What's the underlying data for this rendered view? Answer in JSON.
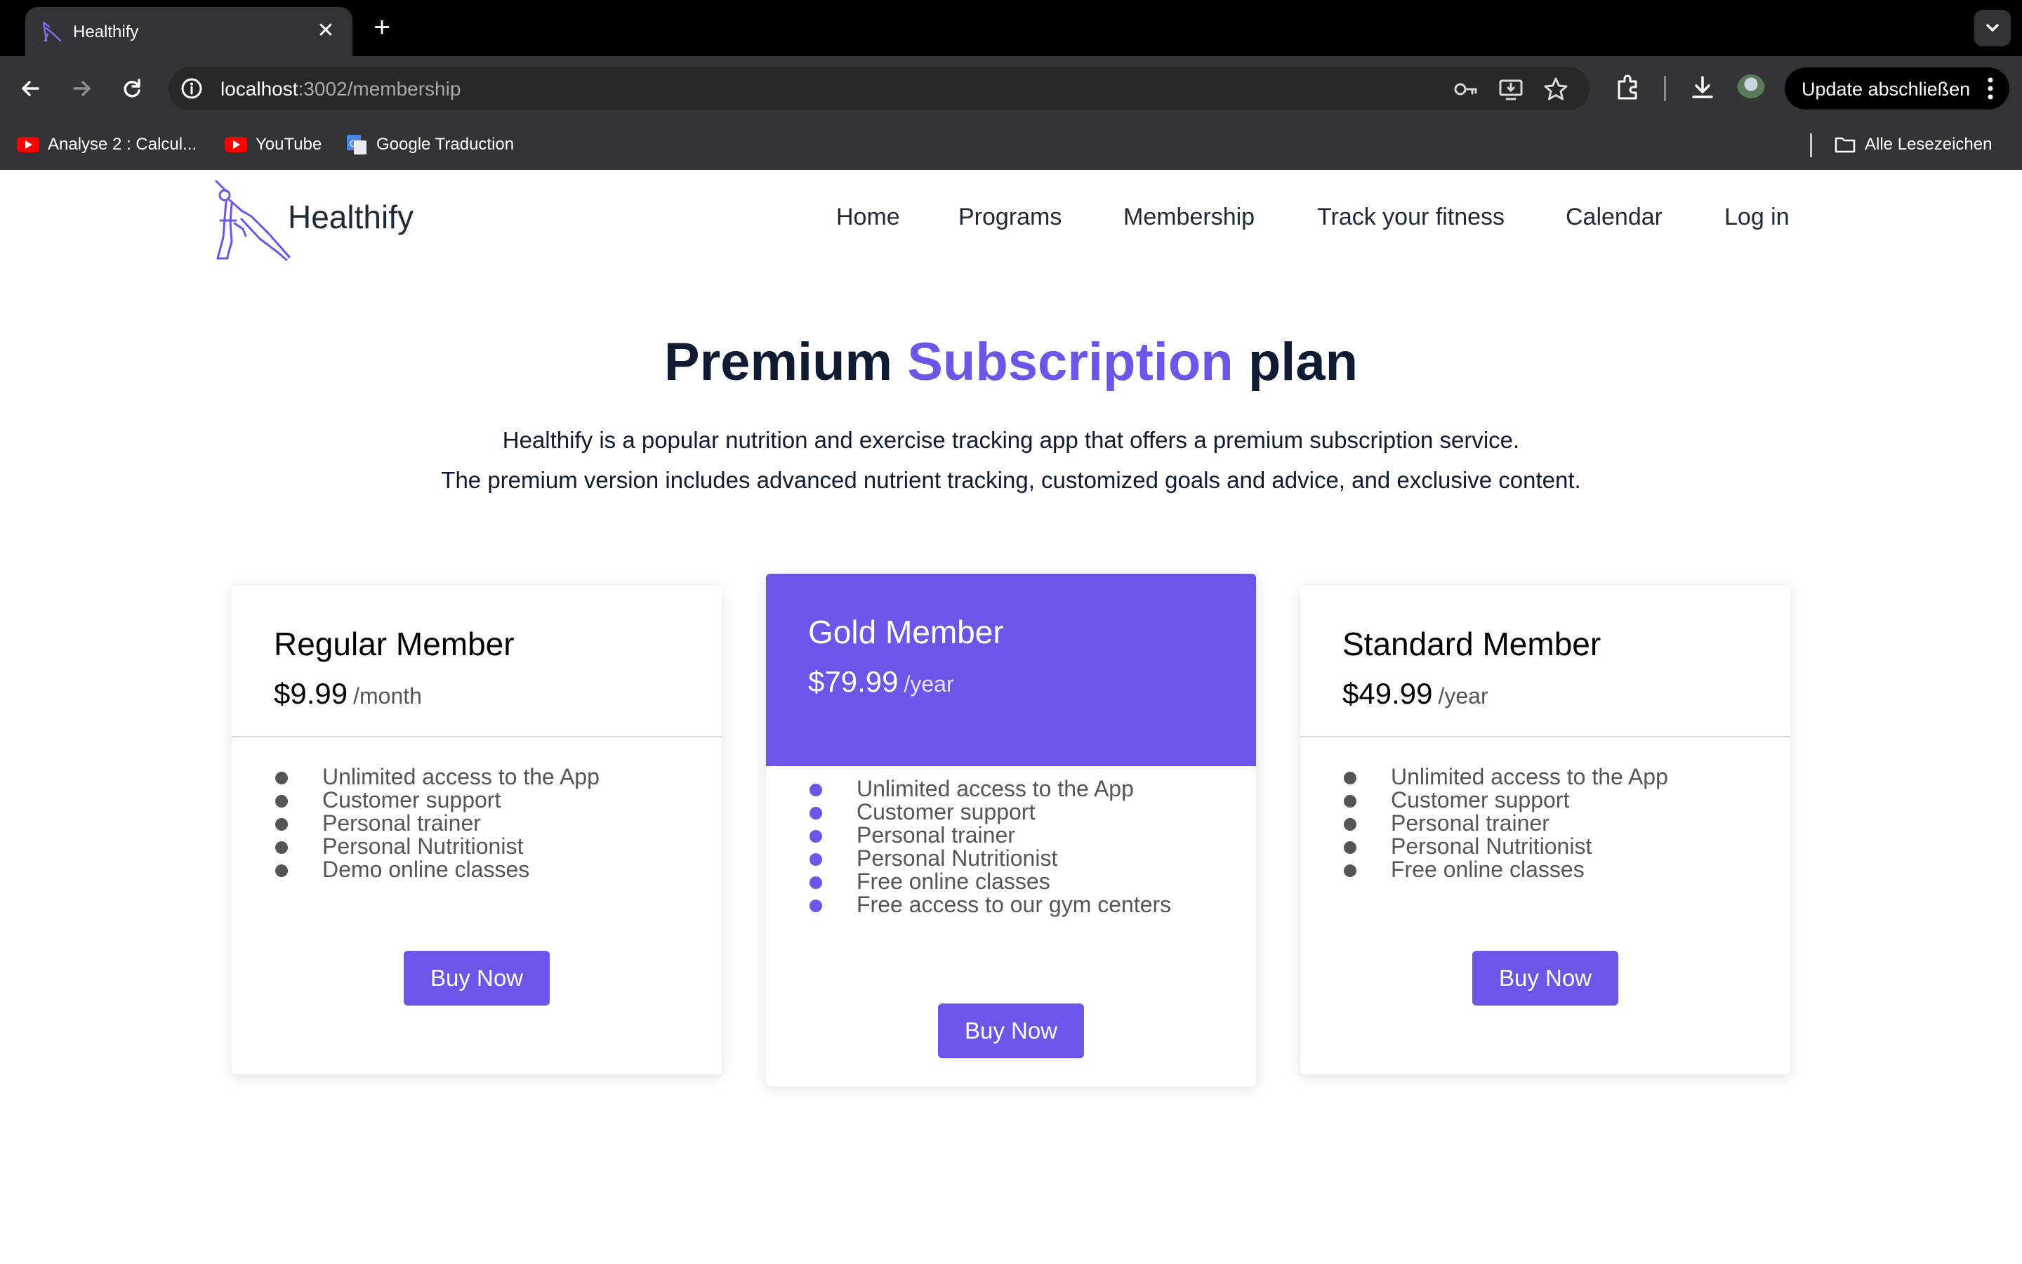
{
  "browser": {
    "tab_title": "Healthify",
    "url_host": "localhost",
    "url_rest": ":3002/membership",
    "update_label": "Update abschließen",
    "bookmarks": [
      {
        "label": "Analyse 2 : Calcul...",
        "icon": "youtube-icon"
      },
      {
        "label": "YouTube",
        "icon": "youtube-icon"
      },
      {
        "label": "Google Traduction",
        "icon": "google-translate-icon"
      }
    ],
    "all_bookmarks_label": "Alle Lesezeichen"
  },
  "site": {
    "brand": "Healthify",
    "nav": [
      "Home",
      "Programs",
      "Membership",
      "Track your fitness",
      "Calendar",
      "Log in"
    ]
  },
  "hero": {
    "title_pre": "Premium ",
    "title_accent": "Subscription",
    "title_post": " plan",
    "line1": "Healthify is a popular nutrition and exercise tracking app that offers a premium subscription service.",
    "line2": "The premium version includes advanced nutrient tracking, customized goals and advice, and exclusive content."
  },
  "plans": [
    {
      "name": "Regular Member",
      "price": "$9.99",
      "period": "/month",
      "features": [
        "Unlimited access to the App",
        "Customer support",
        "Personal trainer",
        "Personal Nutritionist",
        "Demo online classes"
      ],
      "button": "Buy Now"
    },
    {
      "name": "Gold Member",
      "price": "$79.99",
      "period": "/year",
      "features": [
        "Unlimited access to the App",
        "Customer support",
        "Personal trainer",
        "Personal Nutritionist",
        "Free online classes",
        "Free access to our gym centers"
      ],
      "button": "Buy Now"
    },
    {
      "name": "Standard Member",
      "price": "$49.99",
      "period": "/year",
      "features": [
        "Unlimited access to the App",
        "Customer support",
        "Personal trainer",
        "Personal Nutritionist",
        "Free online classes"
      ],
      "button": "Buy Now"
    }
  ],
  "colors": {
    "accent": "#6c55e8",
    "heading": "#0f1a33",
    "chrome_dark": "#333336"
  }
}
